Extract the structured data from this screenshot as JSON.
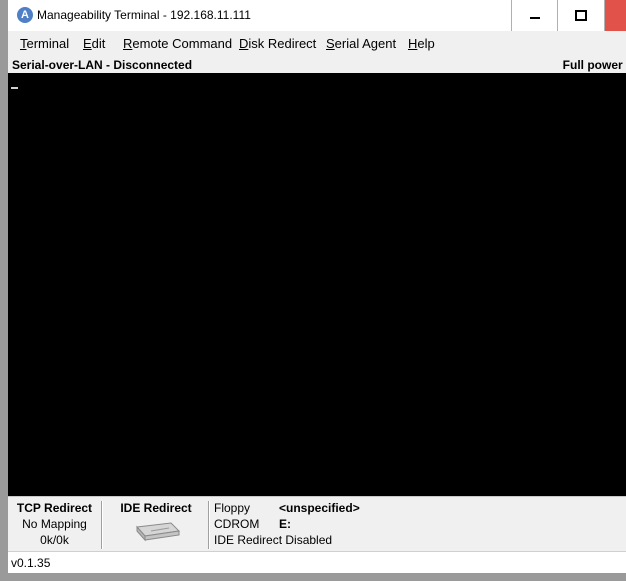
{
  "window": {
    "title": "Manageability Terminal - 192.168.11.111",
    "icon_letter": "A",
    "controls": [
      "minimize-icon",
      "maximize-icon",
      "close-icon"
    ],
    "close_color": "#e0524a"
  },
  "menu": {
    "items": [
      {
        "label": "Terminal",
        "mnemonic": "T",
        "rest": "erminal"
      },
      {
        "label": "Edit",
        "mnemonic": "E",
        "rest": "dit"
      },
      {
        "label": "Remote Command",
        "mnemonic": "R",
        "rest": "emote Command"
      },
      {
        "label": "Disk Redirect",
        "mnemonic": "D",
        "rest": "isk Redirect"
      },
      {
        "label": "Serial Agent",
        "mnemonic": "S",
        "rest": "erial Agent"
      },
      {
        "label": "Help",
        "mnemonic": "H",
        "rest": "elp"
      }
    ]
  },
  "status": {
    "sol": "Serial-over-LAN - Disconnected",
    "power": "Full power ("
  },
  "terminal": {
    "background": "#000000"
  },
  "tcp": {
    "heading": "TCP Redirect",
    "mapping": "No Mapping",
    "traffic": "0k/0k"
  },
  "ide": {
    "heading": "IDE Redirect",
    "icon": "drive-icon"
  },
  "media": {
    "floppy_label": "Floppy",
    "floppy_value": "<unspecified>",
    "cdrom_label": "CDROM",
    "cdrom_value": "E:",
    "ide_redirect_status": "IDE Redirect Disabled"
  },
  "footer": {
    "version": "v0.1.35"
  }
}
